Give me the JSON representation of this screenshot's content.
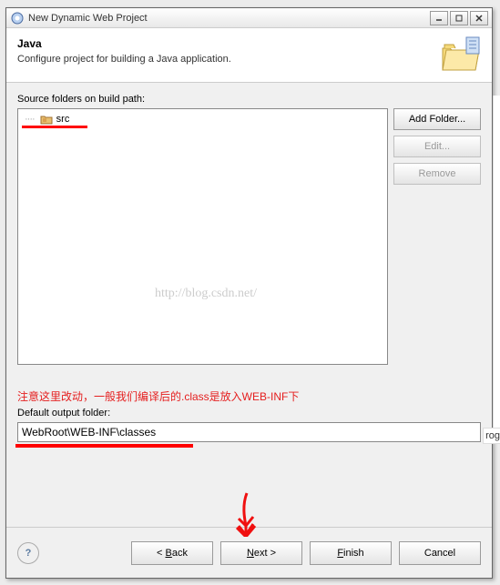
{
  "titlebar": {
    "title": "New Dynamic Web Project"
  },
  "header": {
    "title": "Java",
    "desc": "Configure project for building a Java application."
  },
  "source": {
    "label": "Source folders on build path:",
    "items": [
      {
        "name": "src"
      }
    ],
    "add": "Add Folder...",
    "edit": "Edit...",
    "remove": "Remove"
  },
  "watermark": "http://blog.csdn.net/",
  "annotation": "注意这里改动，一般我们编译后的.class是放入WEB-INF下",
  "output": {
    "label": "Default output folder:",
    "value": "WebRoot\\WEB-INF\\classes"
  },
  "footer": {
    "back": "< Back",
    "next": "Next >",
    "finish": "Finish",
    "cancel": "Cancel"
  },
  "fragment": "rog"
}
